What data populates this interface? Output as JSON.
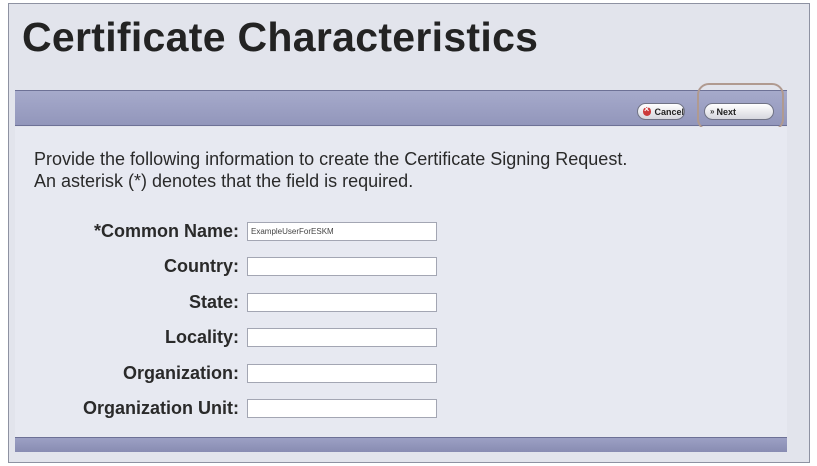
{
  "page": {
    "title": "Certificate Characteristics"
  },
  "toolbar": {
    "cancel_label": "Cancel",
    "next_label": "Next"
  },
  "instructions": {
    "line1": "Provide the following information to create the Certificate Signing Request.",
    "line2": "An asterisk (*) denotes that the field is required."
  },
  "form": {
    "fields": [
      {
        "label": "*Common Name:",
        "value": "ExampleUserForESKM",
        "required": true
      },
      {
        "label": "Country:",
        "value": "",
        "required": false
      },
      {
        "label": "State:",
        "value": "",
        "required": false
      },
      {
        "label": "Locality:",
        "value": "",
        "required": false
      },
      {
        "label": "Organization:",
        "value": "",
        "required": false
      },
      {
        "label": "Organization Unit:",
        "value": "",
        "required": false
      }
    ]
  },
  "colors": {
    "frame_bg": "#e2e4ec",
    "toolbar_bg": "#9ea2c5",
    "cancel_icon": "#cc3a3a",
    "highlight_ring": "#b09a90"
  },
  "icons": {
    "cancel": "cancel-circle-icon",
    "next": "double-chevron-right-icon"
  }
}
